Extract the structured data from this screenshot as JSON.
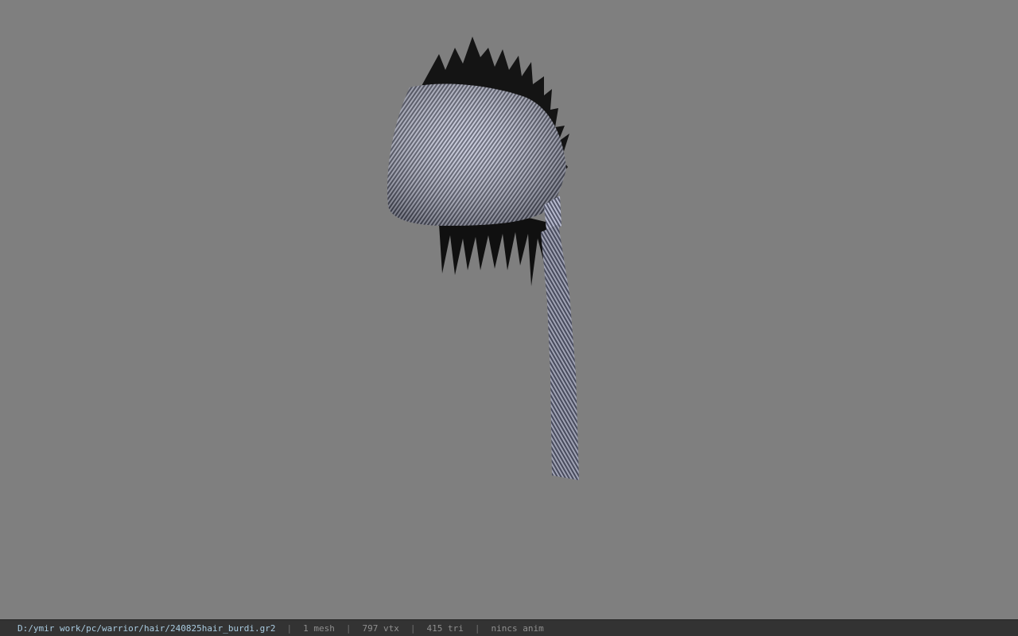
{
  "status_bar": {
    "file_path": "D:/ymir work/pc/warrior/hair/240825hair_burdi.gr2",
    "separator": "|",
    "mesh_count": "1 mesh",
    "vertex_count": "797 vtx",
    "triangle_count": "415 tri",
    "animation": "nincs anim"
  },
  "colors": {
    "viewport_background": "#7f7f7f",
    "status_bar_background": "#333333",
    "path_text": "#a9cbe0",
    "info_text": "#8f8f8f"
  }
}
